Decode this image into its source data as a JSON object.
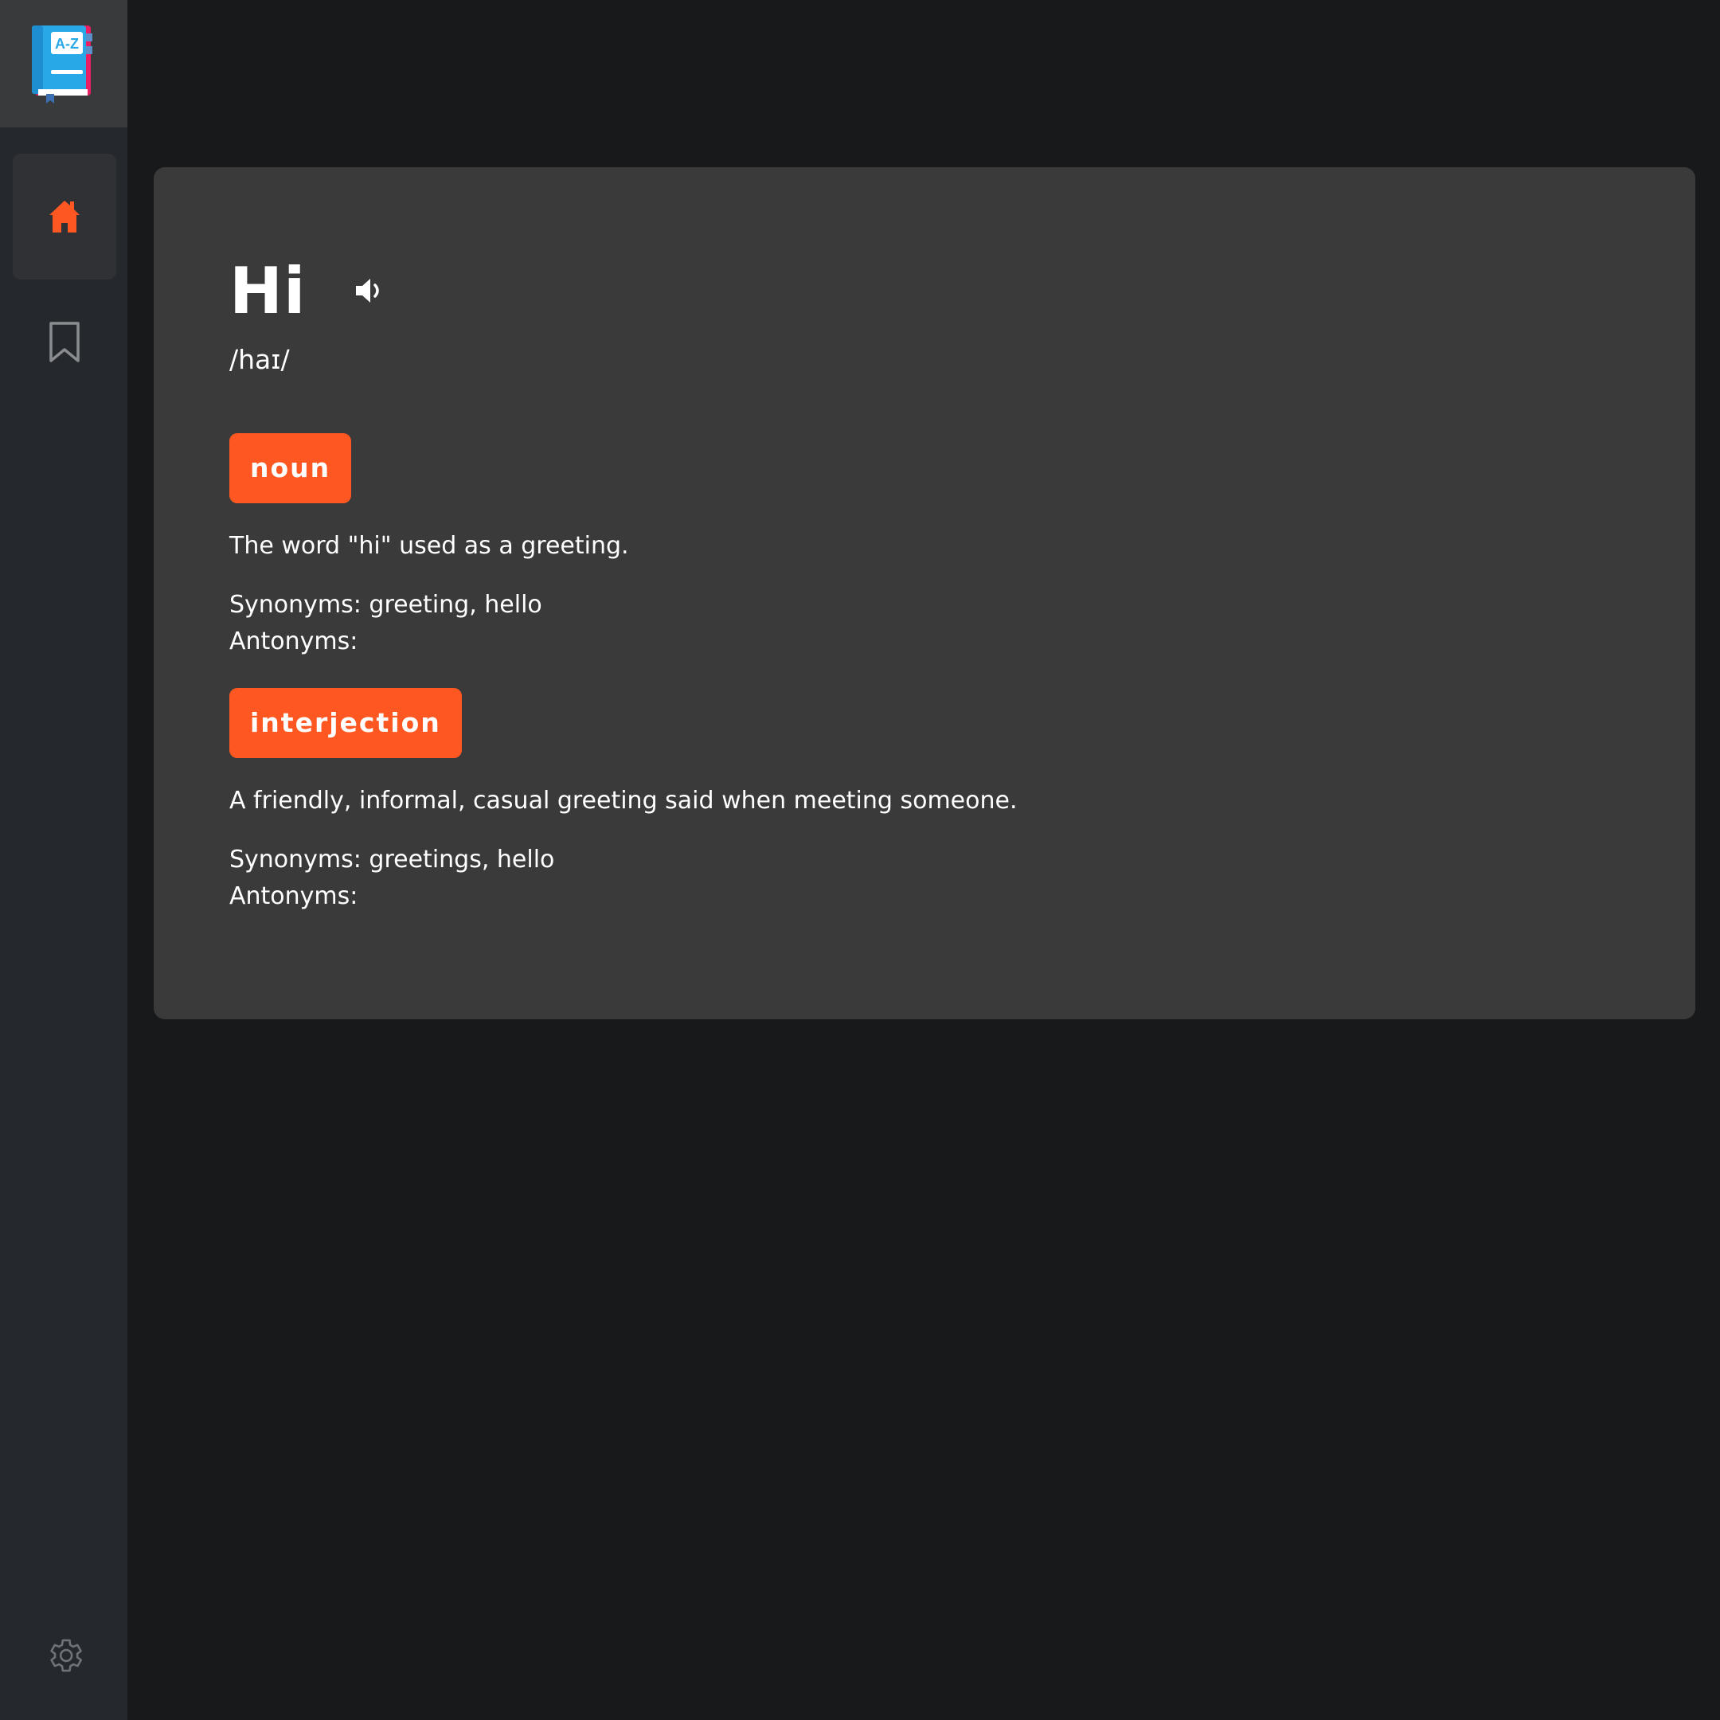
{
  "sidebar": {
    "logo": {
      "icon": "dictionary-book-icon",
      "text": "A-Z"
    },
    "items": [
      {
        "icon": "home-icon",
        "active": true
      },
      {
        "icon": "bookmark-icon",
        "active": false
      }
    ],
    "footer": {
      "icon": "gear-icon"
    }
  },
  "entry": {
    "word": "Hi",
    "phonetic": "/haɪ/",
    "meanings": [
      {
        "part_of_speech": "noun",
        "definition": "The word \"hi\" used as a greeting.",
        "synonyms": "Synonyms: greeting, hello",
        "antonyms": "Antonyms:"
      },
      {
        "part_of_speech": "interjection",
        "definition": "A friendly, informal, casual greeting said when meeting someone.",
        "synonyms": "Synonyms: greetings, hello",
        "antonyms": "Antonyms:"
      }
    ]
  },
  "colors": {
    "accent": "#ff5722",
    "card": "#3a3a3b",
    "background": "#18191b",
    "sidebar": "#25282c"
  }
}
